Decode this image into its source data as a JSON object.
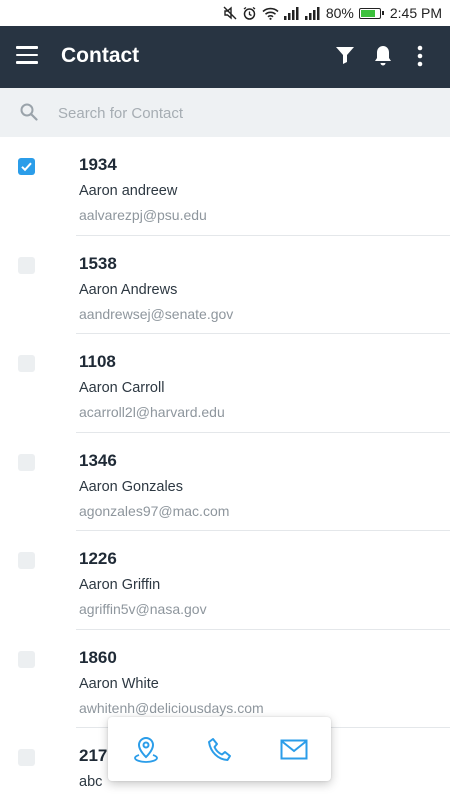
{
  "status_bar": {
    "battery_text": "80%",
    "time": "2:45 PM",
    "battery_level": 0.8
  },
  "app_bar": {
    "title": "Contact",
    "icons": [
      "menu-icon",
      "filter-icon",
      "bell-icon",
      "more-vert-icon"
    ]
  },
  "search": {
    "placeholder": "Search for Contact",
    "value": ""
  },
  "contacts": [
    {
      "id": "1934",
      "name": "Aaron andreew",
      "email": "aalvarezpj@psu.edu",
      "checked": true
    },
    {
      "id": "1538",
      "name": "Aaron Andrews",
      "email": "aandrewsej@senate.gov",
      "checked": false
    },
    {
      "id": "1108",
      "name": "Aaron Carroll",
      "email": "acarroll2l@harvard.edu",
      "checked": false
    },
    {
      "id": "1346",
      "name": "Aaron Gonzales",
      "email": "agonzales97@mac.com",
      "checked": false
    },
    {
      "id": "1226",
      "name": "Aaron Griffin",
      "email": "agriffin5v@nasa.gov",
      "checked": false
    },
    {
      "id": "1860",
      "name": "Aaron White",
      "email": "awhitenh@deliciousdays.com",
      "checked": false
    },
    {
      "id": "217",
      "name": "abc",
      "email": "",
      "checked": false
    }
  ],
  "action_panel": {
    "icons": [
      "location-pin-icon",
      "phone-icon",
      "mail-icon"
    ]
  },
  "colors": {
    "app_bar": "#283442",
    "accent": "#2b9de9",
    "search_bg": "#eef1f3"
  }
}
